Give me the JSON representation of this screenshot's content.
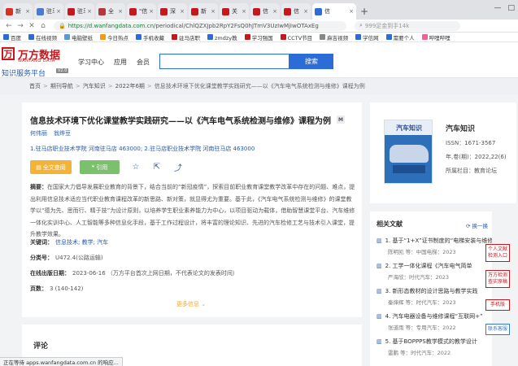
{
  "browser": {
    "tabs": [
      {
        "label": "新",
        "color": "#d93025"
      },
      {
        "label": "驻马",
        "color": "#4a7bd0"
      },
      {
        "label": "驻马",
        "color": "#c8161d"
      },
      {
        "label": "全",
        "color": "#b5373d"
      },
      {
        "label": "\"信",
        "color": "#c8161d"
      },
      {
        "label": "深",
        "color": "#c8161d"
      },
      {
        "label": "新",
        "color": "#c8161d"
      },
      {
        "label": "关",
        "color": "#c8161d"
      },
      {
        "label": "信",
        "color": "#c8161d"
      },
      {
        "label": "信",
        "color": "#c8161d"
      },
      {
        "label": "信",
        "color": "#2b6cd6",
        "active": true
      }
    ],
    "url_domain": "https://d.wanfangdata.com.cn",
    "url_path": "/periodical/ChlQZXJpb2RpY2FsQ0hJTmV3UzIwMjIwOTAxEg",
    "search_placeholder": "999足金到手14k",
    "status_text": "正在等待 apps.wanfangdata.com.cn 的响应..."
  },
  "bookmarks": [
    {
      "label": "百度",
      "color": "#2b6cd6"
    },
    {
      "label": "在线视频",
      "color": "#2b6cd6"
    },
    {
      "label": "电脑壁纸",
      "color": "#5b9bd5"
    },
    {
      "label": "今日热点",
      "color": "#f39c12"
    },
    {
      "label": "手机收藏",
      "color": "#2b6cd6"
    },
    {
      "label": "驻马店职",
      "color": "#c8161d"
    },
    {
      "label": "zmdzy教",
      "color": "#2b6cd6"
    },
    {
      "label": "学习强国",
      "color": "#c8161d"
    },
    {
      "label": "CCTV节目",
      "color": "#c8161d"
    },
    {
      "label": "麻吉视频",
      "color": "#888"
    },
    {
      "label": "学信网",
      "color": "#2b6cd6"
    },
    {
      "label": "需要个人",
      "color": "#2b6cd6"
    },
    {
      "label": "哔哩哔哩",
      "color": "#f06292"
    }
  ],
  "site": {
    "logo_cn": "万方数据",
    "logo_en": "WANFANG DATA",
    "logo_sub": "知识服务平台",
    "logo_ver": "V2.0",
    "nav": [
      "学习中心",
      "应用",
      "会员"
    ],
    "search_button": "搜索"
  },
  "breadcrumb": [
    "首页",
    "期刊导航",
    "汽车知识",
    "2022年6期"
  ],
  "breadcrumb_current": "信息技术环境下优化课堂教学实践研究——以《汽车电气系统检测与维修》课程为例",
  "article": {
    "title": "信息技术环境下优化课堂教学实践研究——以《汽车电气系统检测与维修》课程为例",
    "badge": "M",
    "authors": [
      "何伟丽",
      "翁烨豆"
    ],
    "affiliation": "1.驻马店职业技术学院 河南驻马店 463000; 2.驻马店职业技术学院 河南驻马店 463000",
    "btn_fulltext": "全文查阅",
    "btn_cite": "引用",
    "abstract_label": "摘要：",
    "abstract": "在国家大力倡导发展职业教育的背景下，结合当前的“新冠疫情”，探索目前职业教育课堂教学改革中存在的问题、难点，提出利用信息技术适应当代职业教育课程改革的新思路、新对策，就显得尤为重要。基于此，《汽车电气系统检测与维修》的课堂教学以“德为先、思而行、精于技”为设计原则，以培养学生职业素养能力为中心，以项目驱动为载体，借助智慧课堂平台、汽车维修一体化实训中心、人工智能等多种信息化手段，基于工作过程设计，将丰富的理论知识、先进的汽车检修工艺与技术引入课堂，提升教学效果。",
    "keywords_label": "关键词：",
    "keywords": "信息技术; 教学; 汽车",
    "class_label": "分类号：",
    "class_value": "U472.4(公路运输)",
    "online_label": "在线出版日期：",
    "online_value": "2023-06-16  （万方平台首次上网日期，不代表论文的发表时间）",
    "pages_label": "页数：",
    "pages_value": "3 (140-142)",
    "more": "更多信息"
  },
  "comments": {
    "heading": "评论"
  },
  "journal": {
    "cover_title": "汽车知识",
    "name": "汽车知识",
    "issn": "ISSN：1671-3567",
    "year_issue": "年,卷(期)：2022,22(6)",
    "column": "所属栏目：教育论坛"
  },
  "related": {
    "heading": "相关文献",
    "swap": "换一换",
    "items": [
      {
        "num": "1.",
        "title": "基于“1+X”证书制度的“电梯安装与维修”",
        "sub": "陈明凯 等：中国电梯：2023"
      },
      {
        "num": "2.",
        "title": "工学一体化课程《汽车电气简单",
        "sub": "严海欣：时代汽车：2023"
      },
      {
        "num": "3.",
        "title": "新形态教材的设计思路与教学实践",
        "sub": "秦烽辉 等：时代汽车：2023"
      },
      {
        "num": "4.",
        "title": "汽车电器设备与维修课程“互联网+”",
        "sub": "张道雨 等：专用汽车：2022"
      },
      {
        "num": "5.",
        "title": "基于BOPPPS教学模式的教学设计",
        "sub": "雷鹏 等：时代汽车：2022"
      }
    ]
  },
  "floats": [
    {
      "label": "个人文献检测入口",
      "kind": "red"
    },
    {
      "label": "万方检测查实原稿",
      "kind": "red"
    },
    {
      "label": "手机版",
      "kind": "red"
    },
    {
      "label": "联系客服",
      "kind": "blue"
    }
  ]
}
